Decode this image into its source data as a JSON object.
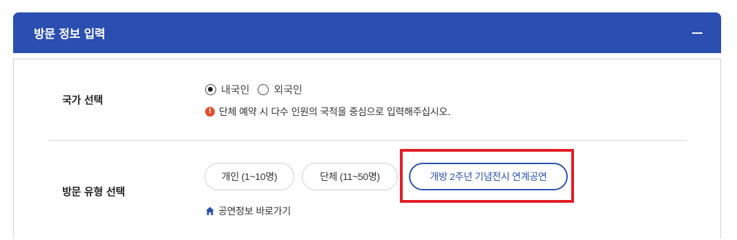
{
  "panel": {
    "title": "방문 정보 입력",
    "collapse_icon": "minus-icon"
  },
  "country": {
    "label": "국가 선택",
    "options": [
      {
        "label": "내국인",
        "checked": true
      },
      {
        "label": "외국인",
        "checked": false
      }
    ],
    "notice_icon": "info-icon",
    "notice": "단체 예약 시 다수 인원의 국적을 중심으로 입력해주십시오."
  },
  "visit_type": {
    "label": "방문 유형 선택",
    "options": [
      {
        "label": "개인 (1~10명)",
        "selected": false
      },
      {
        "label": "단체 (11~50명)",
        "selected": false
      },
      {
        "label": "개방 2주년 기념전시 연계공연",
        "selected": true
      }
    ],
    "link_icon": "home-icon",
    "link": "공연정보 바로가기"
  },
  "colors": {
    "header": "#2a4fb0",
    "accent": "#2a4fb0",
    "notice_icon": "#e0502b",
    "highlight": "#e21c24"
  }
}
